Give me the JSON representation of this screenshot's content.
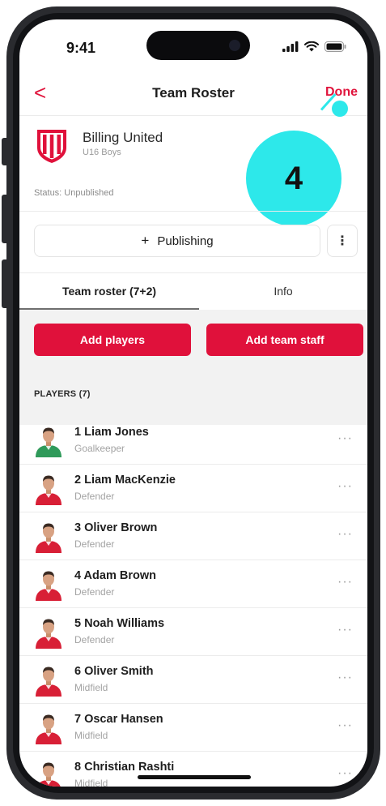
{
  "status_bar": {
    "time": "9:41"
  },
  "nav": {
    "back_glyph": "<",
    "title": "Team Roster",
    "done_label": "Done"
  },
  "team": {
    "name": "Billing United",
    "subtitle": "U16 Boys",
    "status": "Status: Unpublished",
    "crest_colors": {
      "primary": "#e0113b",
      "secondary": "#ffffff"
    }
  },
  "step_badge": {
    "number": "4",
    "color": "#2de8ea"
  },
  "publishing": {
    "plus_glyph": "+",
    "label": "Publishing",
    "more_glyph": "⋮"
  },
  "tabs": [
    {
      "label": "Team roster (7+2)",
      "active": true
    },
    {
      "label": "Info",
      "active": false
    }
  ],
  "actions": {
    "add_players": "Add players",
    "add_staff": "Add team staff",
    "accent": "#e0113b"
  },
  "players_section": {
    "label": "PLAYERS (7)"
  },
  "players": [
    {
      "name": "1 Liam Jones",
      "role": "Goalkeeper",
      "kit": "green"
    },
    {
      "name": "2 Liam MacKenzie",
      "role": "Defender",
      "kit": "red"
    },
    {
      "name": "3 Oliver Brown",
      "role": "Defender",
      "kit": "red"
    },
    {
      "name": "4 Adam Brown",
      "role": "Defender",
      "kit": "red"
    },
    {
      "name": "5 Noah Williams",
      "role": "Defender",
      "kit": "red"
    },
    {
      "name": "6 Oliver Smith",
      "role": "Midfield",
      "kit": "red"
    },
    {
      "name": "7 Oscar Hansen",
      "role": "Midfield",
      "kit": "red"
    },
    {
      "name": "8 Christian Rashti",
      "role": "Midfield",
      "kit": "red"
    }
  ],
  "row_more_glyph": "···"
}
